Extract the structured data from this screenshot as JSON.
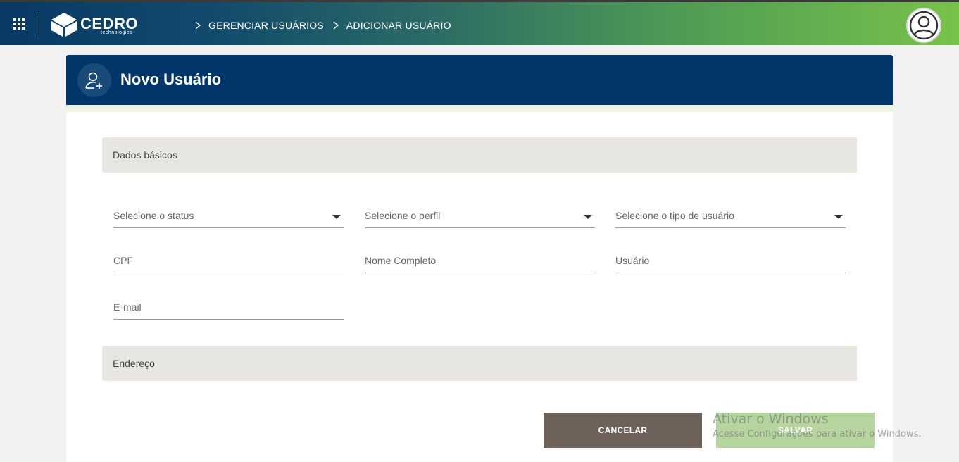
{
  "header": {
    "logo_name": "CEDRO",
    "logo_sub": "technologies",
    "breadcrumb": [
      "GERENCIAR USUÁRIOS",
      "ADICIONAR USUÁRIO"
    ]
  },
  "card": {
    "title": "Novo Usuário"
  },
  "sections": {
    "basic": "Dados básicos",
    "address": "Endereço"
  },
  "fields": {
    "status": "Selecione o status",
    "profile": "Selecione o perfil",
    "user_type": "Selecione o tipo de usuário",
    "cpf": "CPF",
    "full_name": "Nome Completo",
    "username": "Usuário",
    "email": "E-mail"
  },
  "actions": {
    "cancel": "CANCELAR",
    "save": "SALVAR"
  },
  "watermark": {
    "title": "Ativar o Windows",
    "subtitle": "Acesse Configurações para ativar o Windows."
  },
  "colors": {
    "header_blue": "#02366a",
    "accent_green": "#78c24a",
    "cancel_button": "#6d615a",
    "save_button": "#b6d59e",
    "section_bar": "#e8e6e1"
  },
  "icons": {
    "apps": "grid-icon",
    "breadcrumb_separator": "chevron-right-icon",
    "profile": "user-circle-icon",
    "add_user": "user-plus-icon"
  }
}
